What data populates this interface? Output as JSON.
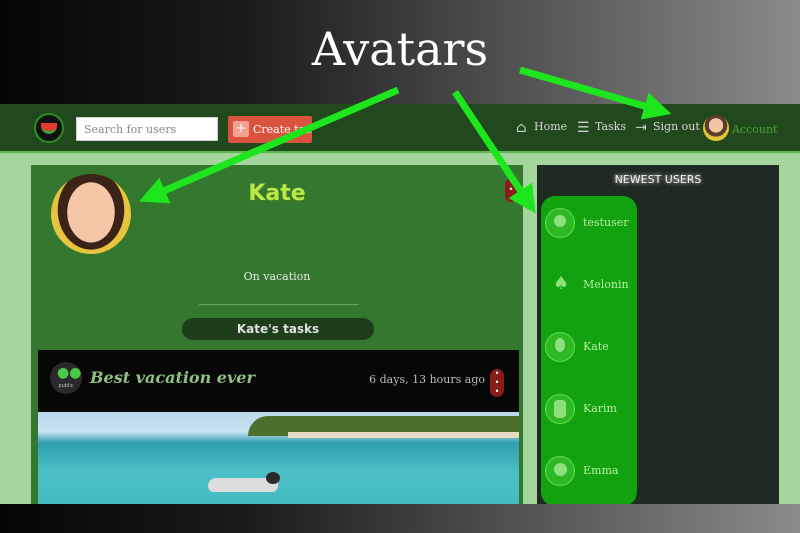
{
  "annotation": {
    "banner": "Avatars"
  },
  "navbar": {
    "search_placeholder": "Search for users",
    "create_label": "Create task",
    "links": {
      "home": "Home",
      "tasks": "Tasks",
      "sign_out": "Sign out",
      "account": "Account"
    }
  },
  "profile": {
    "name": "Kate",
    "bio": "On vacation",
    "tasks_header": "Kate's tasks",
    "task": {
      "title": "Best vacation ever",
      "time": "6 days, 13 hours ago",
      "visibility": "public"
    }
  },
  "sidebar": {
    "title": "NEWEST USERS",
    "users": [
      {
        "name": "testuser"
      },
      {
        "name": "Melonin"
      },
      {
        "name": "Kate"
      },
      {
        "name": "Karim"
      },
      {
        "name": "Emma"
      }
    ]
  },
  "colors": {
    "navbar": "#22491d",
    "profile_bg": "#33782e",
    "sidebar_bg": "#1f2a22",
    "user_panel": "#13a20f",
    "arrow": "#1ee61e"
  },
  "icons": [
    "logo-icon",
    "plus-calendar-icon",
    "home-icon",
    "tasks-icon",
    "sign-out-icon",
    "people-icon",
    "more-vertical-icon"
  ]
}
